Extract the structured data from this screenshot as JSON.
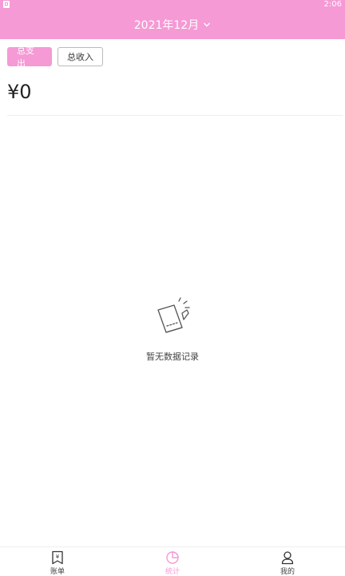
{
  "status": {
    "time": "2:06"
  },
  "header": {
    "month": "2021年12月"
  },
  "tabs": [
    {
      "label": "总支出",
      "active": true
    },
    {
      "label": "总收入",
      "active": false
    }
  ],
  "summary": {
    "amount": "¥0"
  },
  "empty_state": {
    "message": "暂无数据记录"
  },
  "bottom_nav": [
    {
      "label": "账单",
      "icon": "bill-icon",
      "active": false
    },
    {
      "label": "统计",
      "icon": "pie-chart-icon",
      "active": true
    },
    {
      "label": "我的",
      "icon": "user-icon",
      "active": false
    }
  ],
  "colors": {
    "accent": "#f59ad5"
  }
}
